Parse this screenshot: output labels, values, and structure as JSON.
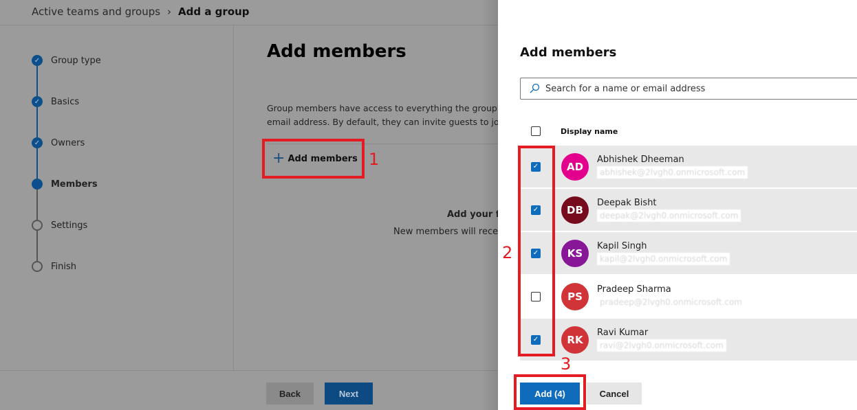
{
  "breadcrumb": {
    "parent": "Active teams and groups",
    "separator": "›",
    "current": "Add a group"
  },
  "steps": [
    {
      "label": "Group type",
      "state": "done"
    },
    {
      "label": "Basics",
      "state": "done"
    },
    {
      "label": "Owners",
      "state": "done"
    },
    {
      "label": "Members",
      "state": "current"
    },
    {
      "label": "Settings",
      "state": "todo"
    },
    {
      "label": "Finish",
      "state": "todo"
    }
  ],
  "main": {
    "title": "Add members",
    "description_line1": "Group members have access to everything the group c",
    "description_line2": "email address. By default, they can invite guests to join",
    "add_members_label": "Add members",
    "empty_title": "Add your fi",
    "empty_text": "New members will receiv",
    "back_label": "Back",
    "next_label": "Next"
  },
  "annotations": {
    "one": "1",
    "two": "2",
    "three": "3",
    "color": "#e51b23"
  },
  "panel": {
    "title": "Add members",
    "search_placeholder": "Search for a name or email address",
    "column_header": "Display name",
    "members": [
      {
        "initials": "AD",
        "name": "Abhishek Dheeman",
        "email": "abhishek@2lvgh0.onmicrosoft.com",
        "color": "#e3008c",
        "checked": true
      },
      {
        "initials": "DB",
        "name": "Deepak Bisht",
        "email": "deepak@2lvgh0.onmicrosoft.com",
        "color": "#750b1c",
        "checked": true
      },
      {
        "initials": "KS",
        "name": "Kapil Singh",
        "email": "kapil@2lvgh0.onmicrosoft.com",
        "color": "#881798",
        "checked": true
      },
      {
        "initials": "PS",
        "name": "Pradeep Sharma",
        "email": "pradeep@2lvgh0.onmicrosoft.com",
        "color": "#d13438",
        "checked": false
      },
      {
        "initials": "RK",
        "name": "Ravi Kumar",
        "email": "ravi@2lvgh0.onmicrosoft.com",
        "color": "#d13438",
        "checked": true
      }
    ],
    "add_label": "Add (4)",
    "cancel_label": "Cancel",
    "accent": "#0f6cbd"
  }
}
